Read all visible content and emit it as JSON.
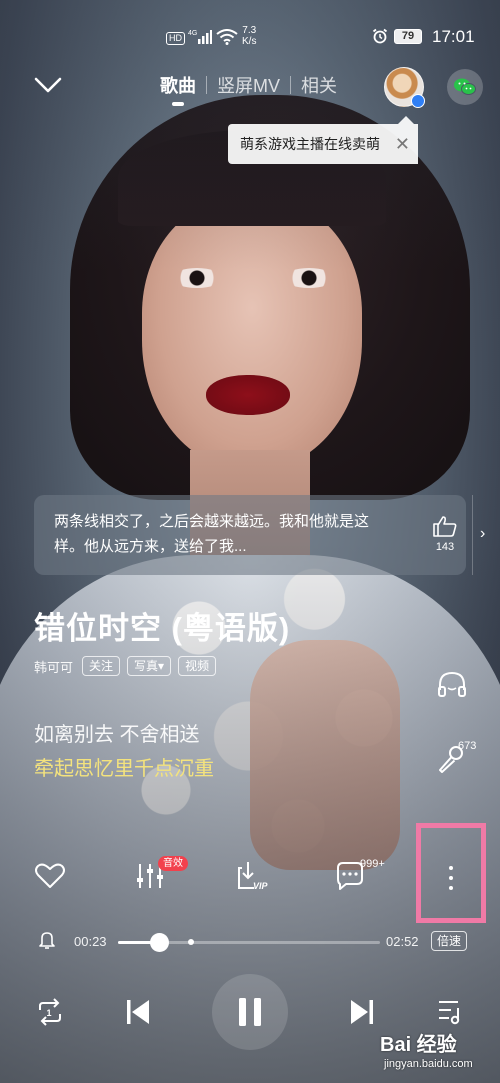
{
  "status_bar": {
    "hd": "HD",
    "network": "4G",
    "speed_value": "7.3",
    "speed_unit": "K/s",
    "battery": "79",
    "time": "17:01"
  },
  "header": {
    "tabs": [
      {
        "label": "歌曲",
        "active": true
      },
      {
        "label": "竖屏MV",
        "active": false
      },
      {
        "label": "相关",
        "active": false
      }
    ]
  },
  "tip": {
    "text": "萌系游戏主播在线卖萌",
    "close": "✕"
  },
  "comment": {
    "text": "两条线相交了，之后会越来越远。我和他就是这样。他从远方来，送给了我...",
    "likes": "143",
    "more": "›"
  },
  "song": {
    "title": "错位时空 (粤语版)",
    "artist": "韩可可",
    "follow": "关注",
    "photos": "写真▾",
    "video": "视频"
  },
  "lyrics": {
    "current": "如离别去 不舍相送",
    "next": "牵起思忆里千点沉重"
  },
  "side": {
    "sing_count": "673"
  },
  "actions": {
    "effect_badge": "音效",
    "comment_count": "999+"
  },
  "progress": {
    "current": "00:23",
    "total": "02:52",
    "fraction": 0.155,
    "speed_label": "倍速"
  },
  "watermark": {
    "text": "Bai 经验",
    "url": "jingyan.baidu.com"
  },
  "colors": {
    "lyric_highlight": "#f4e37d",
    "badge": "#f2414d",
    "highlight_box": "#f07aa6"
  }
}
